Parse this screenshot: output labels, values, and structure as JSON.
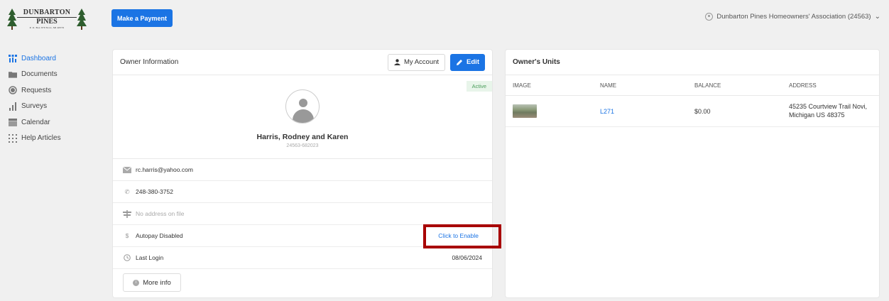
{
  "logo": {
    "line1": "DUNBARTON",
    "line2": "PINES",
    "line3": "P. O. Box 879  Novi, MI  48376"
  },
  "header": {
    "pay_button": "Make a Payment",
    "association": "Dunbarton Pines Homeowners' Association (24563)"
  },
  "sidebar": {
    "items": [
      {
        "label": "Dashboard",
        "icon": "dashboard-icon",
        "active": true
      },
      {
        "label": "Documents",
        "icon": "folder-icon"
      },
      {
        "label": "Requests",
        "icon": "circle-icon"
      },
      {
        "label": "Surveys",
        "icon": "bar-chart-icon"
      },
      {
        "label": "Calendar",
        "icon": "calendar-icon"
      },
      {
        "label": "Help Articles",
        "icon": "grid-icon"
      }
    ]
  },
  "owner_card": {
    "title": "Owner Information",
    "my_account": "My Account",
    "edit": "Edit",
    "status": "Active",
    "name": "Harris, Rodney and Karen",
    "account_id": "24563-682023",
    "email": "rc.harris@yahoo.com",
    "phone": "248-380-3752",
    "address": "No address on file",
    "autopay": "Autopay Disabled",
    "enable_link": "Click to Enable",
    "last_login_label": "Last Login",
    "last_login_value": "08/06/2024",
    "more_info": "More info"
  },
  "units_card": {
    "title": "Owner's Units",
    "columns": [
      "IMAGE",
      "NAME",
      "BALANCE",
      "ADDRESS"
    ],
    "rows": [
      {
        "name": "L271",
        "balance": "$0.00",
        "address_line1": "45235 Courtview Trail Novi,",
        "address_line2": "Michigan US 48375"
      }
    ]
  },
  "colors": {
    "accent": "#1b74e4",
    "active_badge_bg": "#e8f5ea",
    "active_badge_text": "#4a9d5b",
    "highlight": "#a80000"
  }
}
